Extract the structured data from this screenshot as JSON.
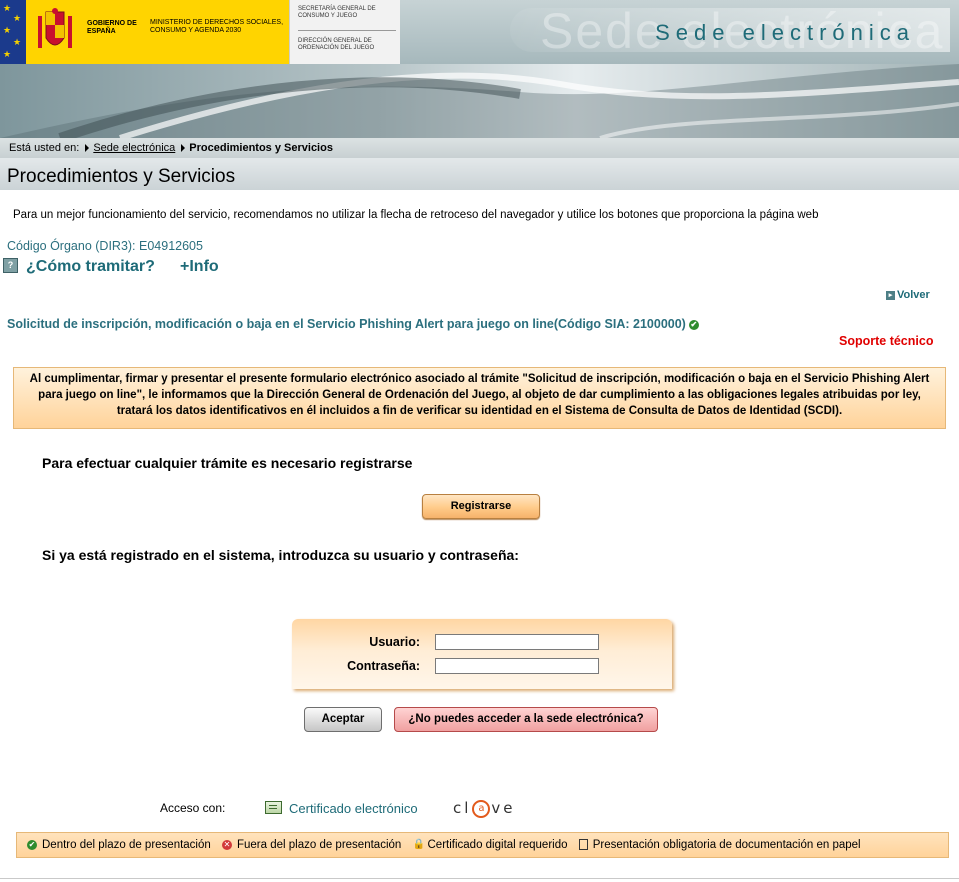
{
  "header": {
    "gobierno": "GOBIERNO DE ESPAÑA",
    "ministerio": "MINISTERIO DE DERECHOS SOCIALES, CONSUMO Y AGENDA 2030",
    "secretaria": "SECRETARÍA GENERAL DE CONSUMO Y JUEGO",
    "direccion": "DIRECCIÓN GENERAL DE ORDENACIÓN DEL JUEGO",
    "sede_ghost": "Sede electrónica",
    "sede_title": "Sede electrónica",
    "colors": {
      "flag_blue": "#1b3a8c",
      "gov_yellow": "#ffd400",
      "sede_teal": "#1e6b78"
    }
  },
  "breadcrumb": {
    "lead": "Está usted en:",
    "items": [
      "Sede electrónica",
      "Procedimientos y Servicios"
    ]
  },
  "page": {
    "title": "Procedimientos y Servicios",
    "recommendation": "Para un mejor funcionamiento del servicio, recomendamos no utilizar la flecha de retroceso del navegador y utilice los botones que proporciona la página web",
    "codigo_organo": "Código Órgano (DIR3): E04912605",
    "como_tramitar": "¿Cómo tramitar?",
    "mas_info": "+Info",
    "volver": "Volver",
    "solicitud": "Solicitud de inscripción, modificación o baja en el Servicio Phishing Alert para juego on line(Código SIA: 2100000)",
    "soporte": "Soporte técnico",
    "legal_notice": "Al cumplimentar, firmar y presentar el presente formulario electrónico asociado al trámite \"Solicitud de inscripción, modificación o baja en el Servicio Phishing Alert para juego on line\", le informamos que la Dirección General de Ordenación del Juego, al objeto de dar cumplimiento a las obligaciones legales atribuidas por ley, tratará los datos identificativos en él incluidos a fin de verificar su identidad en el Sistema de Consulta de Datos de Identidad (SCDI).",
    "colors": {
      "link_teal": "#2b6f7e",
      "support_red": "#e00000",
      "notice_orange": "#ffd39a"
    }
  },
  "register": {
    "heading": "Para efectuar cualquier trámite es necesario registrarse",
    "button": "Registrarse"
  },
  "login": {
    "heading": "Si ya está registrado en el sistema, introduzca su usuario y contraseña:",
    "user_label": "Usuario:",
    "pass_label": "Contraseña:",
    "user_value": "",
    "pass_value": "",
    "accept": "Aceptar",
    "no_access": "¿No puedes acceder a la sede electrónica?"
  },
  "access": {
    "label": "Acceso con:",
    "certificate": "Certificado electrónico",
    "clave_prefix": "cl",
    "clave_a": "a",
    "clave_suffix": "ve"
  },
  "legend": {
    "items": [
      {
        "icon": "check-circle-icon",
        "label": "Dentro del plazo de presentación"
      },
      {
        "icon": "x-circle-icon",
        "label": "Fuera del plazo de presentación"
      },
      {
        "icon": "lock-icon",
        "label": "Certificado digital requerido"
      },
      {
        "icon": "paper-icon",
        "label": "Presentación obligatoria de documentación en papel"
      }
    ]
  }
}
